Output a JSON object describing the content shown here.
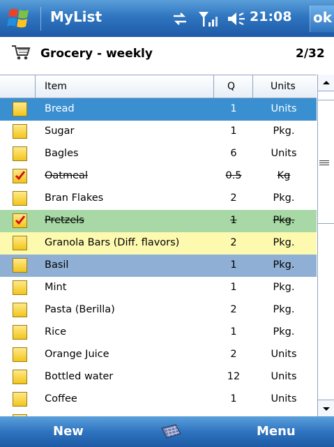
{
  "titlebar": {
    "app_title": "MyList",
    "time": "21:08",
    "ok_label": "ok",
    "icons": [
      "start-logo",
      "connectivity-icon",
      "signal-icon",
      "volume-icon"
    ]
  },
  "list": {
    "name": "Grocery - weekly",
    "count": "2/32",
    "icon": "cart-icon"
  },
  "columns": {
    "item": "Item",
    "qty": "Q",
    "units": "Units"
  },
  "rows": [
    {
      "item": "Bread",
      "qty": "1",
      "units": "Units",
      "checked": false
    },
    {
      "item": "Sugar",
      "qty": "1",
      "units": "Pkg.",
      "checked": false
    },
    {
      "item": "Bagles",
      "qty": "6",
      "units": "Units",
      "checked": false
    },
    {
      "item": "Oatmeal",
      "qty": "0.5",
      "units": "Kg",
      "checked": true
    },
    {
      "item": "Bran Flakes",
      "qty": "2",
      "units": "Pkg.",
      "checked": false
    },
    {
      "item": "Pretzels",
      "qty": "1",
      "units": "Pkg.",
      "checked": true
    },
    {
      "item": "Granola Bars (Diff. flavors)",
      "qty": "2",
      "units": "Pkg.",
      "checked": false
    },
    {
      "item": "Basil",
      "qty": "1",
      "units": "Pkg.",
      "checked": false
    },
    {
      "item": "Mint",
      "qty": "1",
      "units": "Pkg.",
      "checked": false
    },
    {
      "item": "Pasta (Berilla)",
      "qty": "2",
      "units": "Pkg.",
      "checked": false
    },
    {
      "item": "Rice",
      "qty": "1",
      "units": "Pkg.",
      "checked": false
    },
    {
      "item": "Orange Juice",
      "qty": "2",
      "units": "Units",
      "checked": false
    },
    {
      "item": "Bottled water",
      "qty": "12",
      "units": "Units",
      "checked": false
    },
    {
      "item": "Coffee",
      "qty": "1",
      "units": "Units",
      "checked": false
    }
  ],
  "softkeys": {
    "left": "New",
    "right": "Menu",
    "center_icon": "keyboard-icon"
  },
  "colors": {
    "titlebar": "#2f75c0",
    "selected_row": "#3a8fd0",
    "highlight_row": "#8fb0d4",
    "checked_row": "#a7d8a5",
    "note_row": "#fdfab0",
    "checkbox": "#f2c51b",
    "checkmark": "#d01010"
  }
}
